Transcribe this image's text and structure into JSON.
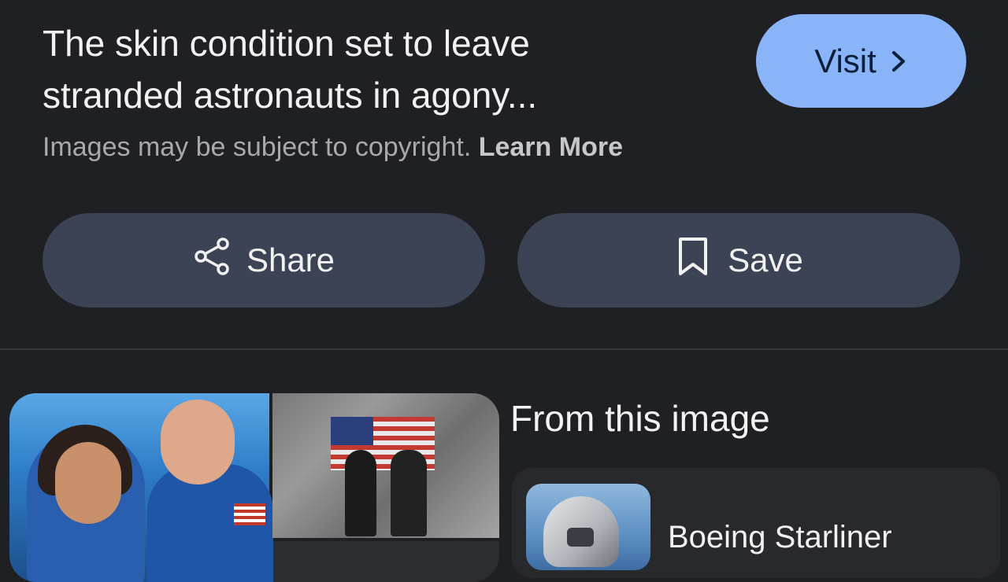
{
  "result": {
    "title_line1": "The skin condition set to leave",
    "title_line2": "stranded astronauts in agony...",
    "copyright_text": "Images may be subject to copyright.",
    "learn_more": "Learn More",
    "visit_label": "Visit"
  },
  "actions": {
    "share_label": "Share",
    "save_label": "Save"
  },
  "from_image": {
    "heading": "From this image",
    "items": [
      {
        "title": "Boeing Starliner"
      }
    ]
  },
  "colors": {
    "background": "#1f2024",
    "accent": "#8ab4f8",
    "button": "#3c4354"
  },
  "icons": {
    "visit": "chevron-right-icon",
    "share": "share-icon",
    "save": "bookmark-icon"
  }
}
